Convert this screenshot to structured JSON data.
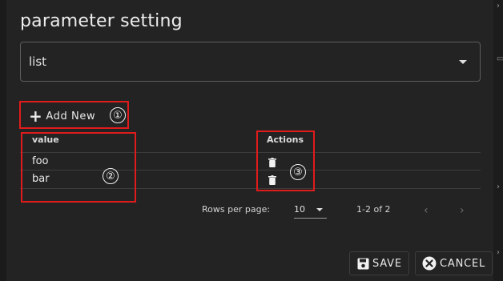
{
  "dialog": {
    "title": "parameter setting",
    "select": {
      "value": "list"
    },
    "add_button": {
      "label": "Add New"
    },
    "annotations": [
      "①",
      "②",
      "③"
    ],
    "table": {
      "columns": [
        "value",
        "Actions"
      ],
      "rows": [
        {
          "value": "foo"
        },
        {
          "value": "bar"
        }
      ]
    },
    "pagination": {
      "rows_per_page_label": "Rows per page:",
      "rows_per_page_value": "10",
      "range_text": "1-2 of 2"
    },
    "footer": {
      "save_label": "SAVE",
      "cancel_label": "CANCEL"
    }
  },
  "colors": {
    "background": "#232323",
    "annotation_red": "#e01b1b",
    "text": "#e8e8e8"
  },
  "icons": [
    "plus-icon",
    "trash-icon",
    "chevron-left-icon",
    "chevron-right-icon",
    "floppy-disk-icon",
    "close-circle-icon",
    "dropdown-caret-icon"
  ]
}
